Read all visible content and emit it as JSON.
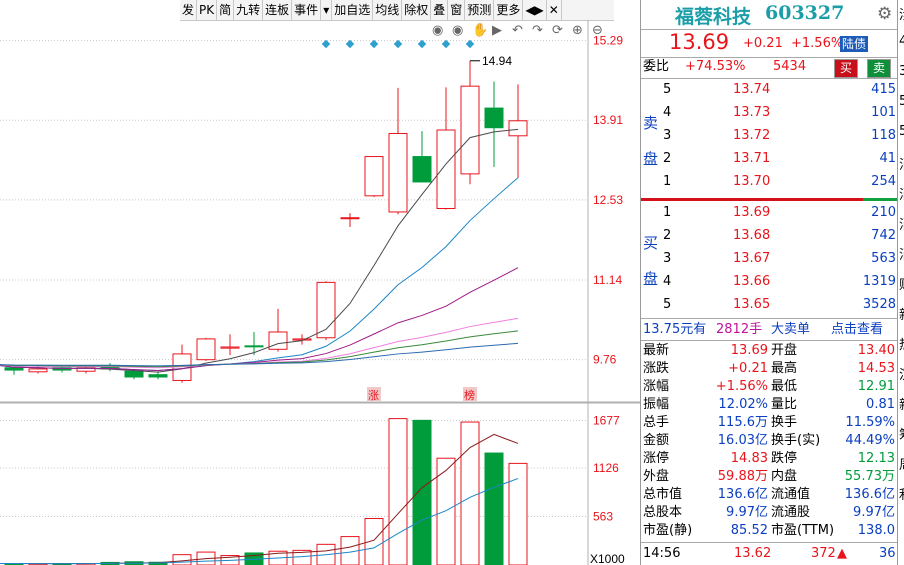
{
  "toolbar": [
    "发",
    "PK",
    "简",
    "九转",
    "连板",
    "事件",
    "▾",
    "加自选",
    "均线",
    "除权",
    "叠",
    "窗",
    "预测",
    "更多",
    "◀▶",
    "✕"
  ],
  "chart": {
    "price_axis": [
      "15.29",
      "13.91",
      "12.53",
      "11.14",
      "9.76"
    ],
    "volume_axis": [
      "1677",
      "1126",
      "563"
    ],
    "volume_unit": "X1000",
    "high_label": "14.94",
    "markers": [
      "涨",
      "榜"
    ],
    "tool_icons": [
      "eye-icon",
      "eye-icon",
      "hand-icon",
      "play-icon",
      "undo-icon",
      "redo-icon",
      "refresh-icon",
      "zoom-in-icon",
      "zoom-out-icon"
    ]
  },
  "chart_data": {
    "type": "candlestick",
    "candles": [
      {
        "o": 9.58,
        "c": 9.68,
        "h": 9.72,
        "l": 9.54
      },
      {
        "o": 9.62,
        "c": 9.58,
        "h": 9.64,
        "l": 9.5
      },
      {
        "o": 9.55,
        "c": 9.6,
        "h": 9.64,
        "l": 9.52
      },
      {
        "o": 9.62,
        "c": 9.58,
        "h": 9.66,
        "l": 9.54
      },
      {
        "o": 9.56,
        "c": 9.62,
        "h": 9.64,
        "l": 9.52
      },
      {
        "o": 9.66,
        "c": 9.6,
        "h": 9.7,
        "l": 9.56
      },
      {
        "o": 9.56,
        "c": 9.46,
        "h": 9.6,
        "l": 9.42
      },
      {
        "o": 9.5,
        "c": 9.46,
        "h": 9.56,
        "l": 9.42
      },
      {
        "o": 9.4,
        "c": 9.86,
        "h": 10.02,
        "l": 9.36
      },
      {
        "o": 9.76,
        "c": 10.12,
        "h": 10.14,
        "l": 9.74
      },
      {
        "o": 9.96,
        "c": 9.98,
        "h": 10.2,
        "l": 9.84
      },
      {
        "o": 10.0,
        "c": 9.99,
        "h": 10.24,
        "l": 9.84
      },
      {
        "o": 9.94,
        "c": 10.24,
        "h": 10.64,
        "l": 9.9
      },
      {
        "o": 10.1,
        "c": 10.12,
        "h": 10.2,
        "l": 10.02
      },
      {
        "o": 10.14,
        "c": 11.1,
        "h": 11.12,
        "l": 10.1
      },
      {
        "o": 12.22,
        "c": 12.22,
        "h": 12.3,
        "l": 12.06
      },
      {
        "o": 12.6,
        "c": 13.28,
        "h": 13.28,
        "l": 12.58
      },
      {
        "o": 12.32,
        "c": 13.68,
        "h": 14.47,
        "l": 12.28
      },
      {
        "o": 13.28,
        "c": 12.84,
        "h": 13.72,
        "l": 12.84
      },
      {
        "o": 12.38,
        "c": 13.74,
        "h": 14.48,
        "l": 12.36
      },
      {
        "o": 12.98,
        "c": 14.5,
        "h": 14.94,
        "l": 12.8
      },
      {
        "o": 14.12,
        "c": 13.78,
        "h": 14.58,
        "l": 13.1
      },
      {
        "o": 13.64,
        "c": 13.9,
        "h": 14.53,
        "l": 12.91
      }
    ],
    "volume": [
      18,
      16,
      15,
      16,
      17,
      30,
      38,
      32,
      120,
      150,
      110,
      140,
      160,
      170,
      240,
      330,
      540,
      1700,
      1680,
      1240,
      1660,
      1300,
      1180
    ],
    "ylim": [
      9.2,
      15.3
    ],
    "vol_ylim": [
      0,
      1800
    ]
  },
  "stock": {
    "name": "福蓉科技",
    "code": "603327",
    "price": "13.69",
    "change": "+0.21",
    "pct": "+1.56%",
    "badge": "陆债",
    "weibi_label": "委比",
    "weibi": "+74.53%",
    "weicha": "5434",
    "buy_btn": "买",
    "sell_btn": "卖"
  },
  "sell_label": [
    "卖",
    "盘"
  ],
  "buy_label": [
    "买",
    "盘"
  ],
  "asks": [
    {
      "lvl": "5",
      "price": "13.74",
      "vol": "415"
    },
    {
      "lvl": "4",
      "price": "13.73",
      "vol": "101"
    },
    {
      "lvl": "3",
      "price": "13.72",
      "vol": "118"
    },
    {
      "lvl": "2",
      "price": "13.71",
      "vol": "41"
    },
    {
      "lvl": "1",
      "price": "13.70",
      "vol": "254"
    }
  ],
  "bids": [
    {
      "lvl": "1",
      "price": "13.69",
      "vol": "210"
    },
    {
      "lvl": "2",
      "price": "13.68",
      "vol": "742"
    },
    {
      "lvl": "3",
      "price": "13.67",
      "vol": "563"
    },
    {
      "lvl": "4",
      "price": "13.66",
      "vol": "1319"
    },
    {
      "lvl": "5",
      "price": "13.65",
      "vol": "3528"
    }
  ],
  "bigorder": {
    "price": "13.75元有",
    "vol": "2812手",
    "text": "大卖单",
    "link": "点击查看"
  },
  "stats": [
    {
      "l1": "最新",
      "v1": "13.69",
      "c1": "red",
      "l2": "开盘",
      "v2": "13.40",
      "c2": "red"
    },
    {
      "l1": "涨跌",
      "v1": "+0.21",
      "c1": "red",
      "l2": "最高",
      "v2": "14.53",
      "c2": "red"
    },
    {
      "l1": "涨幅",
      "v1": "+1.56%",
      "c1": "red",
      "l2": "最低",
      "v2": "12.91",
      "c2": "green"
    },
    {
      "l1": "振幅",
      "v1": "12.02%",
      "c1": "",
      "l2": "量比",
      "v2": "0.81",
      "c2": ""
    },
    {
      "l1": "总手",
      "v1": "115.6万",
      "c1": "",
      "l2": "换手",
      "v2": "11.59%",
      "c2": ""
    },
    {
      "l1": "金额",
      "v1": "16.03亿",
      "c1": "",
      "l2": "换手(实)",
      "v2": "44.49%",
      "c2": ""
    },
    {
      "l1": "涨停",
      "v1": "14.83",
      "c1": "red",
      "l2": "跌停",
      "v2": "12.13",
      "c2": "green"
    },
    {
      "l1": "外盘",
      "v1": "59.88万",
      "c1": "red",
      "l2": "内盘",
      "v2": "55.73万",
      "c2": "green"
    },
    {
      "l1": "总市值",
      "v1": "136.6亿",
      "c1": "",
      "l2": "流通值",
      "v2": "136.6亿",
      "c2": ""
    },
    {
      "l1": "总股本",
      "v1": "9.97亿",
      "c1": "",
      "l2": "流通股",
      "v2": "9.97亿",
      "c2": ""
    },
    {
      "l1": "市盈(静)",
      "v1": "85.52",
      "c1": "",
      "l2": "市盈(TTM)",
      "v2": "138.0",
      "c2": ""
    }
  ],
  "tick": {
    "time": "14:56",
    "price": "13.62",
    "vol": "372",
    "arrow": "▲",
    "count": "36"
  },
  "side_chars": [
    "涉",
    "4",
    "3",
    "5",
    "5",
    "消",
    "消",
    "消",
    "消",
    "财",
    "新",
    "热",
    "沉",
    "新",
    "筹",
    "周",
    "利"
  ],
  "colors": {
    "up": "#e8141c",
    "down": "#009c3c",
    "blue": "#0b3fbf"
  }
}
